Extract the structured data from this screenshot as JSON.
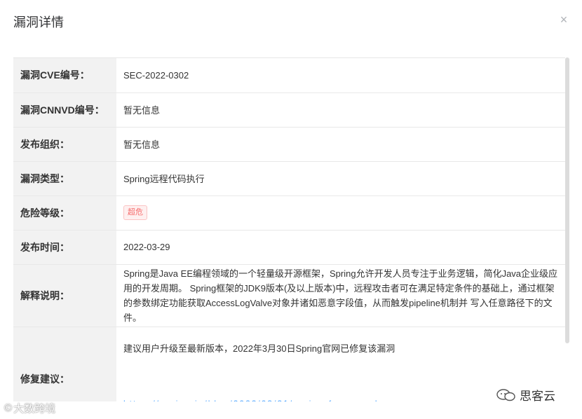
{
  "dialog": {
    "title": "漏洞详情",
    "close_icon": "close-icon"
  },
  "rows": {
    "cve": {
      "label": "漏洞CVE编号：",
      "value": "SEC-2022-0302"
    },
    "cnnvd": {
      "label": "漏洞CNNVD编号：",
      "value": "暂无信息"
    },
    "org": {
      "label": "发布组织：",
      "value": "暂无信息"
    },
    "type": {
      "label": "漏洞类型：",
      "value": "Spring远程代码执行"
    },
    "level": {
      "label": "危险等级：",
      "value": "超危",
      "badge_color": "#f56c6c"
    },
    "date": {
      "label": "发布时间：",
      "value": "2022-03-29"
    },
    "desc": {
      "label": "解释说明：",
      "value": "Spring是Java EE编程领域的一个轻量级开源框架，Spring允许开发人员专注于业务逻辑，简化Java企业级应用的开发周期。 Spring框架的JDK9版本(及以上版本)中，远程攻击者可在满足特定条件的基础上，通过框架的参数绑定功能获取AccessLogValve对象并诸如恶意字段值，从而触发pipeline机制并 写入任意路径下的文件。"
    },
    "fix": {
      "label": "修复建议：",
      "value": "建议用户升级至最新版本，2022年3月30日Spring官网已修复该漏洞"
    }
  },
  "watermarks": {
    "left": "大数跨境",
    "right": "思客云"
  }
}
